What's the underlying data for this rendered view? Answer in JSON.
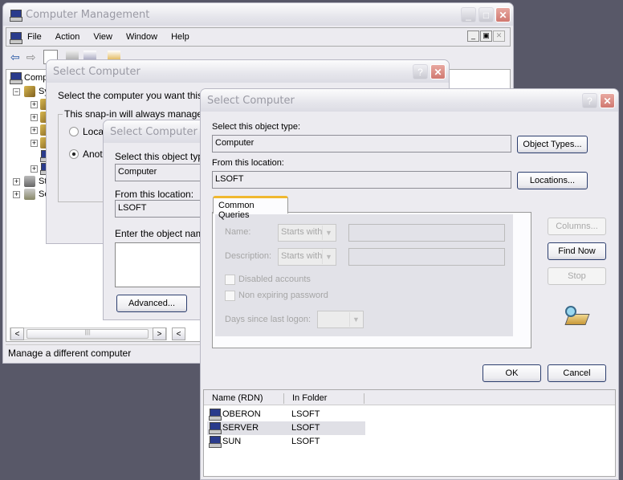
{
  "mmc": {
    "title": "Computer Management",
    "menu": [
      "File",
      "Action",
      "View",
      "Window",
      "Help"
    ],
    "tree_root": "Comp",
    "tree_items": [
      "Sy",
      "St",
      "Se"
    ],
    "status": "Manage a different computer"
  },
  "dialog1": {
    "title": "Select Computer",
    "prompt": "Select the computer you want this sna",
    "group_label": "This snap-in will always manage:",
    "radio_local": "Local",
    "radio_another": "Anoth"
  },
  "dialog2": {
    "title": "Select Computer",
    "object_type_label": "Select this object type",
    "object_type_value": "Computer",
    "location_label": "From this location:",
    "location_value": "LSOFT",
    "enter_label": "Enter the object name",
    "advanced_button": "Advanced..."
  },
  "dialog3": {
    "title": "Select Computer",
    "object_type_label": "Select this object type:",
    "object_type_value": "Computer",
    "object_types_button": "Object Types...",
    "location_label": "From this location:",
    "location_value": "LSOFT",
    "locations_button": "Locations...",
    "tab": "Common Queries",
    "name_label": "Name:",
    "name_op": "Starts with",
    "description_label": "Description:",
    "description_op": "Starts with",
    "disabled_accounts": "Disabled accounts",
    "non_expiring": "Non expiring password",
    "days_label": "Days since last logon:",
    "columns_button": "Columns...",
    "find_now_button": "Find Now",
    "stop_button": "Stop",
    "ok_button": "OK",
    "cancel_button": "Cancel",
    "results": {
      "headers": [
        "Name (RDN)",
        "In Folder"
      ],
      "rows": [
        {
          "name": "OBERON",
          "folder": "LSOFT",
          "selected": false
        },
        {
          "name": "SERVER",
          "folder": "LSOFT",
          "selected": true
        },
        {
          "name": "SUN",
          "folder": "LSOFT",
          "selected": false
        }
      ]
    }
  }
}
